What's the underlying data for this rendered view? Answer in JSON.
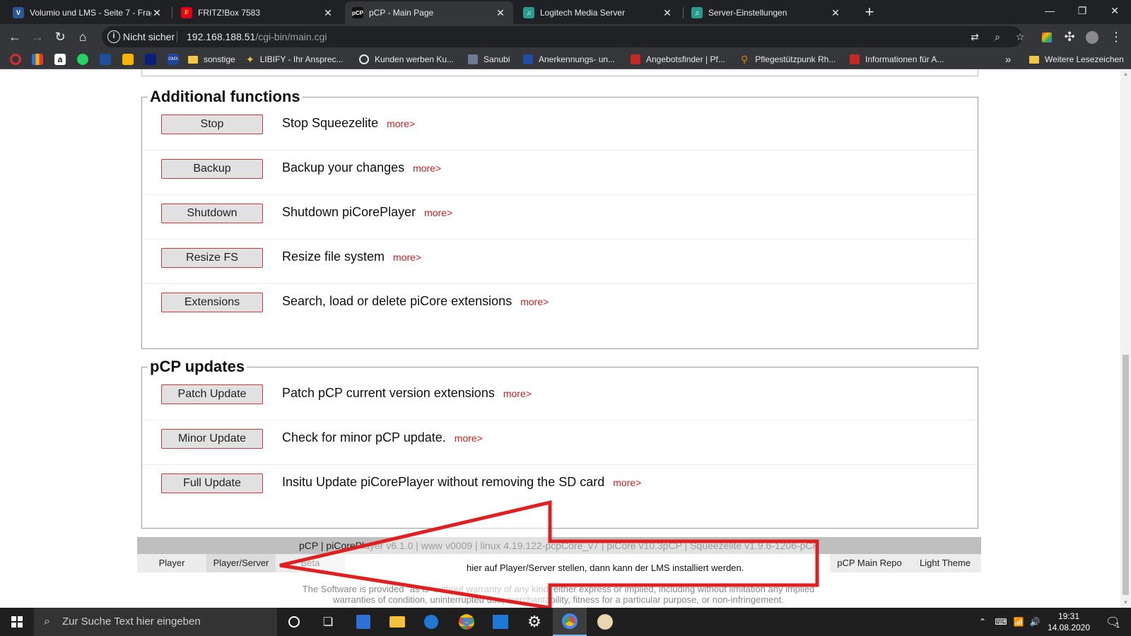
{
  "browser": {
    "tabs": [
      {
        "title": "Volumio und LMS - Seite 7 - Frag",
        "favicon": "forum-favicon",
        "color": "#2b5797"
      },
      {
        "title": "FRITZ!Box 7583",
        "favicon": "fritzbox-favicon",
        "color": "#e2001a"
      },
      {
        "title": "pCP - Main Page",
        "favicon": "pcp-favicon",
        "color": "#000000"
      },
      {
        "title": "Logitech Media Server",
        "favicon": "lms-favicon",
        "color": "#2a9d8f"
      },
      {
        "title": "Server-Einstellungen",
        "favicon": "lms-favicon",
        "color": "#2a9d8f"
      }
    ],
    "active_tab": 2,
    "address": {
      "security_label": "Nicht sicher",
      "host": "192.168.188.51",
      "path": "/cgi-bin/main.cgi"
    },
    "bookmarks": [
      {
        "label": "sonstige",
        "icon": "folder-icon"
      },
      {
        "label": "LIBIFY - Ihr Ansprec...",
        "icon": "star-icon"
      },
      {
        "label": "Kunden werben Ku...",
        "icon": "bookmark-icon"
      },
      {
        "label": "Sanubi",
        "icon": "bookmark-icon"
      },
      {
        "label": "Anerkennungs- un...",
        "icon": "bookmark-icon"
      },
      {
        "label": "Angebotsfinder | Pf...",
        "icon": "bookmark-icon"
      },
      {
        "label": "Pflegestützpunk Rh...",
        "icon": "bookmark-icon"
      },
      {
        "label": "Informationen für A...",
        "icon": "bookmark-icon"
      }
    ],
    "more_bookmarks": "»",
    "other_bookmarks": "Weitere Lesezeichen"
  },
  "sections": {
    "additional": {
      "title": "Additional functions",
      "rows": [
        {
          "button": "Stop",
          "description": "Stop Squeezelite",
          "more": "more>"
        },
        {
          "button": "Backup",
          "description": "Backup your changes",
          "more": "more>"
        },
        {
          "button": "Shutdown",
          "description": "Shutdown piCorePlayer",
          "more": "more>"
        },
        {
          "button": "Resize FS",
          "description": "Resize file system",
          "more": "more>"
        },
        {
          "button": "Extensions",
          "description": "Search, load or delete piCore extensions",
          "more": "more>"
        }
      ]
    },
    "updates": {
      "title": "pCP updates",
      "rows": [
        {
          "button": "Patch Update",
          "description": "Patch pCP current version extensions",
          "more": "more>"
        },
        {
          "button": "Minor Update",
          "description": "Check for minor pCP update.",
          "more": "more>"
        },
        {
          "button": "Full Update",
          "description": "Insitu Update piCorePlayer without removing the SD card",
          "more": "more>"
        }
      ]
    }
  },
  "footer": {
    "version_line": "pCP | piCorePlayer v6.1.0 | www v0009 | linux 4.19.122-pcpCore_v7 | piCore v10.3pCP | Squeezelite v1.9.6-1206-pCP",
    "tabs_left": [
      "Player",
      "Player/Server",
      "Beta"
    ],
    "selected_tab": "Player/Server",
    "tabs_right": [
      "pCP Main Repo",
      "Light Theme"
    ],
    "annotation": "hier auf Player/Server stellen, dann kann der LMS installiert werden.",
    "disclaimer_1": "The Software is provided \"as is\" without warranty of any kind, either express or implied, including without limitation any implied",
    "disclaimer_2": "warranties of condition, uninterrupted use, merchantability, fitness for a particular purpose, or non-infringement."
  },
  "annotation_color": "#e02020",
  "taskbar": {
    "search_placeholder": "Zur Suche Text hier eingeben",
    "clock_time": "19:31",
    "clock_date": "14.08.2020",
    "notification_count": "1"
  }
}
